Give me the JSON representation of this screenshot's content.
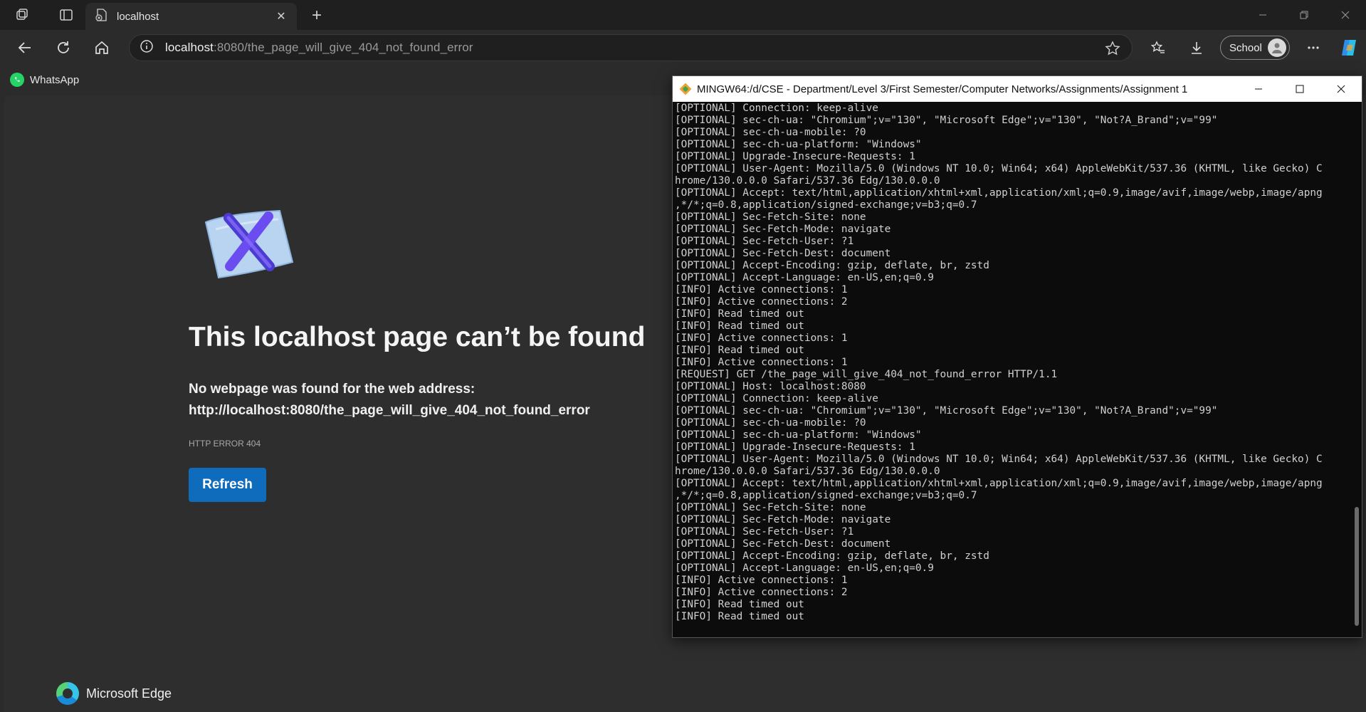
{
  "browser": {
    "tab": {
      "title": "localhost",
      "close": "✕"
    },
    "new_tab": "+",
    "address": {
      "host": "localhost",
      "rest": ":8080/the_page_will_give_404_not_found_error"
    },
    "profile": {
      "label": "School"
    },
    "bookmarks": [
      {
        "label": "WhatsApp"
      }
    ]
  },
  "error_page": {
    "title": "This localhost page can’t be found",
    "desc_line1": "No webpage was found for the web address:",
    "desc_line2": "http://localhost:8080/the_page_will_give_404_not_found_error",
    "code": "HTTP ERROR 404",
    "refresh_label": "Refresh",
    "brand": "Microsoft Edge"
  },
  "terminal": {
    "title": "MINGW64:/d/CSE - Department/Level 3/First Semester/Computer Networks/Assignments/Assignment 1",
    "lines": [
      "[OPTIONAL] Connection: keep-alive",
      "[OPTIONAL] sec-ch-ua: \"Chromium\";v=\"130\", \"Microsoft Edge\";v=\"130\", \"Not?A_Brand\";v=\"99\"",
      "[OPTIONAL] sec-ch-ua-mobile: ?0",
      "[OPTIONAL] sec-ch-ua-platform: \"Windows\"",
      "[OPTIONAL] Upgrade-Insecure-Requests: 1",
      "[OPTIONAL] User-Agent: Mozilla/5.0 (Windows NT 10.0; Win64; x64) AppleWebKit/537.36 (KHTML, like Gecko) C",
      "hrome/130.0.0.0 Safari/537.36 Edg/130.0.0.0",
      "[OPTIONAL] Accept: text/html,application/xhtml+xml,application/xml;q=0.9,image/avif,image/webp,image/apng",
      ",*/*;q=0.8,application/signed-exchange;v=b3;q=0.7",
      "[OPTIONAL] Sec-Fetch-Site: none",
      "[OPTIONAL] Sec-Fetch-Mode: navigate",
      "[OPTIONAL] Sec-Fetch-User: ?1",
      "[OPTIONAL] Sec-Fetch-Dest: document",
      "[OPTIONAL] Accept-Encoding: gzip, deflate, br, zstd",
      "[OPTIONAL] Accept-Language: en-US,en;q=0.9",
      "[INFO] Active connections: 1",
      "[INFO] Active connections: 2",
      "[INFO] Read timed out",
      "[INFO] Read timed out",
      "[INFO] Active connections: 1",
      "[INFO] Read timed out",
      "[INFO] Active connections: 1",
      "[REQUEST] GET /the_page_will_give_404_not_found_error HTTP/1.1",
      "[OPTIONAL] Host: localhost:8080",
      "[OPTIONAL] Connection: keep-alive",
      "[OPTIONAL] sec-ch-ua: \"Chromium\";v=\"130\", \"Microsoft Edge\";v=\"130\", \"Not?A_Brand\";v=\"99\"",
      "[OPTIONAL] sec-ch-ua-mobile: ?0",
      "[OPTIONAL] sec-ch-ua-platform: \"Windows\"",
      "[OPTIONAL] Upgrade-Insecure-Requests: 1",
      "[OPTIONAL] User-Agent: Mozilla/5.0 (Windows NT 10.0; Win64; x64) AppleWebKit/537.36 (KHTML, like Gecko) C",
      "hrome/130.0.0.0 Safari/537.36 Edg/130.0.0.0",
      "[OPTIONAL] Accept: text/html,application/xhtml+xml,application/xml;q=0.9,image/avif,image/webp,image/apng",
      ",*/*;q=0.8,application/signed-exchange;v=b3;q=0.7",
      "[OPTIONAL] Sec-Fetch-Site: none",
      "[OPTIONAL] Sec-Fetch-Mode: navigate",
      "[OPTIONAL] Sec-Fetch-User: ?1",
      "[OPTIONAL] Sec-Fetch-Dest: document",
      "[OPTIONAL] Accept-Encoding: gzip, deflate, br, zstd",
      "[OPTIONAL] Accept-Language: en-US,en;q=0.9",
      "[INFO] Active connections: 1",
      "[INFO] Active connections: 2",
      "[INFO] Read timed out",
      "[INFO] Read timed out"
    ]
  },
  "colors": {
    "accent": "#0f6cbd",
    "page_bg": "#2e2e2e",
    "terminal_bg": "#0c0c0c"
  },
  "icons": [
    "workspaces-icon",
    "tab-actions-icon",
    "site-favicon",
    "back-icon",
    "reload-icon",
    "home-icon",
    "info-icon",
    "favorite-star-icon",
    "favorites-icon",
    "downloads-icon",
    "more-icon",
    "copilot-icon",
    "whatsapp-icon",
    "error-document-icon",
    "edge-logo-icon",
    "git-bash-icon"
  ]
}
